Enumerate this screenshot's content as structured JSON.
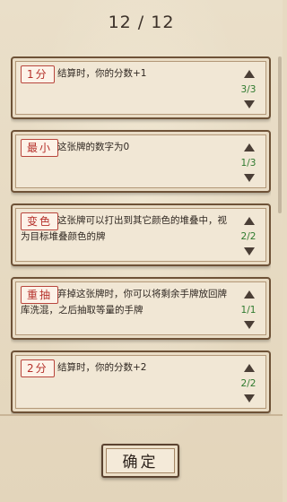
{
  "header": {
    "counter": "12 / 12"
  },
  "cards": [
    {
      "tag": "1分",
      "description": "结算时，你的分数+1",
      "count": "3/3"
    },
    {
      "tag": "最小",
      "description": "这张牌的数字为0",
      "count": "1/3"
    },
    {
      "tag": "变色",
      "description": "这张牌可以打出到其它颜色的堆叠中，视为目标堆叠颜色的牌",
      "count": "2/2"
    },
    {
      "tag": "重抽",
      "description": "弃掉这张牌时，你可以将剩余手牌放回牌库洗混，之后抽取等量的手牌",
      "count": "1/1"
    },
    {
      "tag": "2分",
      "description": "结算时，你的分数+2",
      "count": "2/2"
    }
  ],
  "footer": {
    "confirm_label": "确定"
  }
}
